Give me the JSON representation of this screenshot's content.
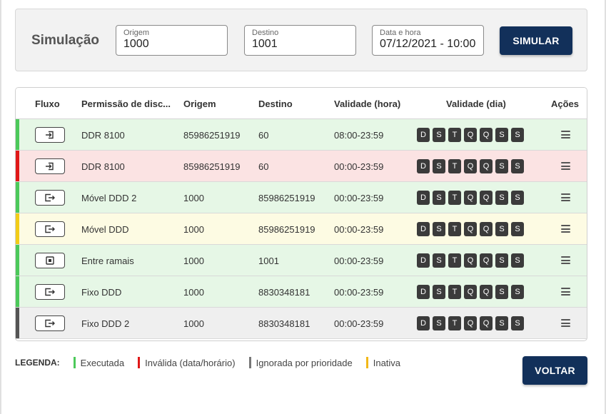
{
  "simulation": {
    "title": "Simulação",
    "origin": {
      "label": "Origem",
      "value": "1000"
    },
    "destination": {
      "label": "Destino",
      "value": "1001"
    },
    "datetime": {
      "label": "Data e hora",
      "value": "07/12/2021 - 10:00"
    },
    "simulate_button": "SIMULAR"
  },
  "table": {
    "headers": [
      "Fluxo",
      "Permissão de disc...",
      "Origem",
      "Destino",
      "Validade (hora)",
      "Validade (dia)",
      "Ações"
    ],
    "day_labels": [
      "D",
      "S",
      "T",
      "Q",
      "Q",
      "S",
      "S"
    ],
    "rows": [
      {
        "flow_icon": "inbound-arrow-icon",
        "status": "Executada",
        "permission": "DDR 8100",
        "origin": "85986251919",
        "destination": "60",
        "hours": "08:00-23:59"
      },
      {
        "flow_icon": "inbound-arrow-icon",
        "status": "Inválida",
        "permission": "DDR 8100",
        "origin": "85986251919",
        "destination": "60",
        "hours": "00:00-23:59"
      },
      {
        "flow_icon": "outbound-arrow-icon",
        "status": "Executada",
        "permission": "Móvel DDD 2",
        "origin": "1000",
        "destination": "85986251919",
        "hours": "00:00-23:59"
      },
      {
        "flow_icon": "outbound-arrow-icon",
        "status": "Inativa",
        "permission": "Móvel DDD",
        "origin": "1000",
        "destination": "85986251919",
        "hours": "00:00-23:59"
      },
      {
        "flow_icon": "internal-dot-icon",
        "status": "Executada",
        "permission": "Entre ramais",
        "origin": "1000",
        "destination": "1001",
        "hours": "00:00-23:59"
      },
      {
        "flow_icon": "outbound-arrow-icon",
        "status": "Executada",
        "permission": "Fixo DDD",
        "origin": "1000",
        "destination": "8830348181",
        "hours": "00:00-23:59"
      },
      {
        "flow_icon": "outbound-arrow-icon",
        "status": "Ignorada",
        "permission": "Fixo DDD 2",
        "origin": "1000",
        "destination": "8830348181",
        "hours": "00:00-23:59"
      }
    ]
  },
  "status_colors": {
    "Executada": {
      "bar": "#4cc95a",
      "bg": "#e6f7e6"
    },
    "Inválida": {
      "bar": "#e01818",
      "bg": "#fbe3e3"
    },
    "Inativa": {
      "bar": "#f2cc18",
      "bg": "#fdfbe3"
    },
    "Ignorada": {
      "bar": "#555555",
      "bg": "#efefef"
    }
  },
  "legend": {
    "title": "LEGENDA:",
    "items": [
      {
        "label": "Executada",
        "color": "#4cc95a"
      },
      {
        "label": "Inválida (data/horário)",
        "color": "#e01818"
      },
      {
        "label": "Ignorada por prioridade",
        "color": "#777777"
      },
      {
        "label": "Inativa",
        "color": "#f2b818"
      }
    ]
  },
  "back_button": "VOLTAR"
}
